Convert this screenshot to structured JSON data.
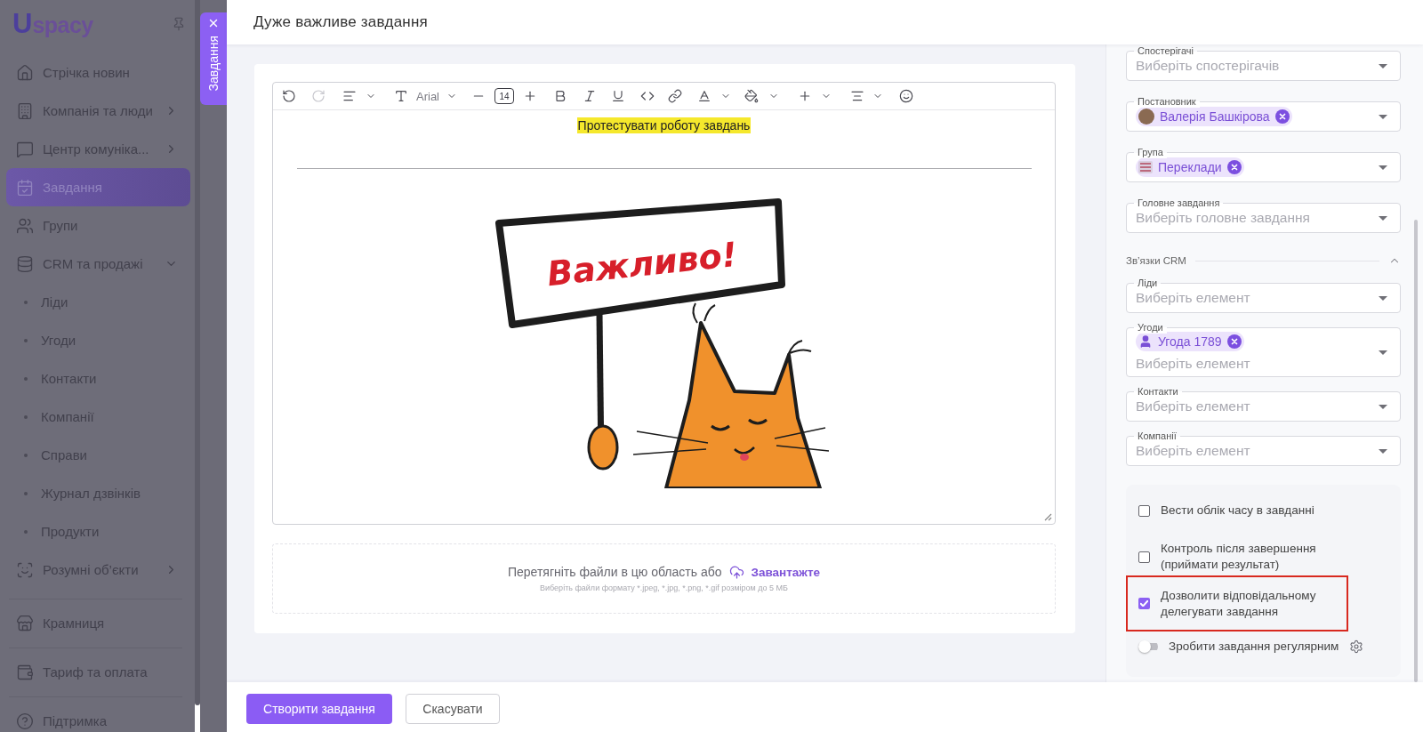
{
  "sidebar": {
    "logo": {
      "mark": "U",
      "wordmark": "spacy"
    },
    "sections": [
      {
        "items": [
          {
            "kind": "link",
            "label": "Стрічка новин",
            "selected": false
          },
          {
            "kind": "group",
            "label": "Компанія та люди",
            "selected": false,
            "expanded": false
          },
          {
            "kind": "group",
            "label": "Центр комуніка...",
            "selected": false,
            "expanded": false
          },
          {
            "kind": "link",
            "label": "Завдання",
            "selected": true
          },
          {
            "kind": "link",
            "label": "Групи",
            "selected": false
          },
          {
            "kind": "group",
            "label": "CRM та продажі",
            "selected": false,
            "expanded": true,
            "children": [
              {
                "label": "Ліди",
                "selected": false
              },
              {
                "label": "Угоди",
                "selected": false
              },
              {
                "label": "Контакти",
                "selected": false
              },
              {
                "label": "Компанії",
                "selected": false
              },
              {
                "label": "Справи",
                "selected": false
              },
              {
                "label": "Журнал дзвінків",
                "selected": false
              },
              {
                "label": "Продукти",
                "selected": false
              }
            ]
          },
          {
            "kind": "group",
            "label": "Розумні об’єкти",
            "selected": false,
            "expanded": false
          }
        ]
      },
      {
        "items": [
          {
            "kind": "link",
            "label": "Крамниця",
            "selected": false
          }
        ]
      },
      {
        "items": [
          {
            "kind": "link",
            "label": "Тариф та оплата",
            "selected": false
          }
        ]
      },
      {
        "items": [
          {
            "kind": "link",
            "label": "Підтримка",
            "selected": false
          }
        ]
      }
    ]
  },
  "drawer": {
    "tab": {
      "label": "Завдання"
    },
    "title": "Дуже важливе завдання",
    "editor": {
      "toolbar": {
        "undo_disabled": false,
        "redo_disabled": true,
        "font": "Arial",
        "font_size": "14"
      },
      "content": {
        "highlighted_text": "Протестувати роботу завдань",
        "image": {
          "sign_text": "Важливо!"
        }
      }
    },
    "upload": {
      "prompt": "Перетягніть файли в цю область або",
      "link": "Завантажте",
      "hint": "Виберіть файли формату *.jpeg, *.jpg, *.png, *.gif розміром до 5 МБ"
    },
    "fields": [
      {
        "label": "Спостерігачі",
        "placeholder": "Виберіть спостерігачів"
      },
      {
        "label": "Постановник",
        "chips": [
          {
            "kind": "person",
            "label": "Валерія Башкірова"
          }
        ]
      },
      {
        "label": "Група",
        "chips": [
          {
            "kind": "group",
            "label": "Переклади"
          }
        ]
      },
      {
        "label": "Головне завдання",
        "placeholder": "Виберіть головне завдання"
      }
    ],
    "crm": {
      "title": "Зв’язки CRM",
      "expanded": true,
      "fields": [
        {
          "label": "Ліди",
          "placeholder": "Виберіть елемент"
        },
        {
          "label": "Угоди",
          "chips": [
            {
              "kind": "deal",
              "label": "Угода 1789"
            }
          ],
          "placeholder": "Виберіть елемент"
        },
        {
          "label": "Контакти",
          "placeholder": "Виберіть елемент"
        },
        {
          "label": "Компанії",
          "placeholder": "Виберіть елемент"
        }
      ]
    },
    "options": [
      {
        "kind": "checkbox",
        "label": "Вести облік часу в завданні",
        "checked": false,
        "highlighted": false
      },
      {
        "kind": "checkbox",
        "label": "Контроль після завершення (приймати результат)",
        "checked": false,
        "highlighted": false
      },
      {
        "kind": "checkbox",
        "label": "Дозволити відповідальному делегувати завдання",
        "checked": true,
        "highlighted": true
      },
      {
        "kind": "toggle",
        "label": "Зробити завдання регулярним",
        "on": false
      }
    ],
    "buttons": [
      {
        "kind": "primary",
        "label": "Створити завдання"
      },
      {
        "kind": "secondary",
        "label": "Скасувати"
      }
    ]
  }
}
